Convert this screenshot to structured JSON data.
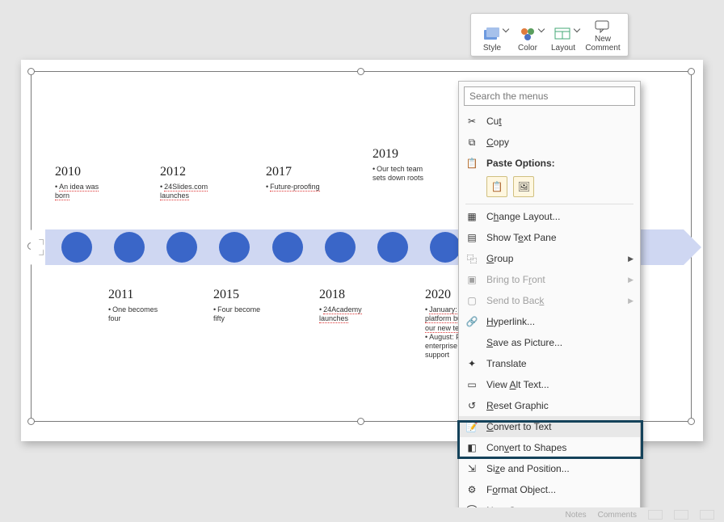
{
  "mini_toolbar": {
    "style": "Style",
    "color": "Color",
    "layout": "Layout",
    "newcomment": "New\nComment"
  },
  "search_placeholder": "Search the menus",
  "menu": {
    "cut": "Cut",
    "copy": "Copy",
    "paste_label": "Paste Options:",
    "change_layout": "Change Layout...",
    "show_text_pane": "Show Text Pane",
    "group": "Group",
    "bring_front": "Bring to Front",
    "send_back": "Send to Back",
    "hyperlink": "Hyperlink...",
    "save_pic": "Save as Picture...",
    "translate": "Translate",
    "alt_text": "View Alt Text...",
    "reset": "Reset Graphic",
    "convert_text": "Convert to Text",
    "convert_shapes": "Convert to Shapes",
    "size_pos": "Size and Position...",
    "format_obj": "Format Object...",
    "new_comment": "New Comment"
  },
  "timeline": {
    "top": [
      {
        "year": "2010",
        "lines": [
          "An idea was born"
        ],
        "squig": [
          0
        ]
      },
      {
        "year": "2012",
        "lines": [
          "24Slides.com launches"
        ],
        "squig": [
          0
        ]
      },
      {
        "year": "2017",
        "lines": [
          "Future-proofing"
        ],
        "squig": [
          0
        ]
      },
      {
        "year": "2019",
        "lines": [
          "Our tech team sets down roots"
        ]
      }
    ],
    "bottom": [
      {
        "year": "2011",
        "lines": [
          "One becomes four"
        ]
      },
      {
        "year": "2015",
        "lines": [
          "Four become fifty"
        ]
      },
      {
        "year": "2018",
        "lines": [
          "24Academy launches"
        ],
        "squig": [
          0
        ]
      },
      {
        "year": "2020",
        "lines": [
          "January: A platform built by our new team",
          "August: Full enterprise support"
        ],
        "squig": [
          0
        ]
      }
    ]
  },
  "status": {
    "notes": "Notes",
    "comments": "Comments"
  },
  "chart_data": {
    "type": "timeline",
    "points": [
      {
        "year": 2010,
        "text": "An idea was born"
      },
      {
        "year": 2011,
        "text": "One becomes four"
      },
      {
        "year": 2012,
        "text": "24Slides.com launches"
      },
      {
        "year": 2015,
        "text": "Four become fifty"
      },
      {
        "year": 2017,
        "text": "Future-proofing"
      },
      {
        "year": 2018,
        "text": "24Academy launches"
      },
      {
        "year": 2019,
        "text": "Our tech team sets down roots"
      },
      {
        "year": 2020,
        "text": "January: A platform built by our new team; August: Full enterprise support"
      }
    ]
  }
}
